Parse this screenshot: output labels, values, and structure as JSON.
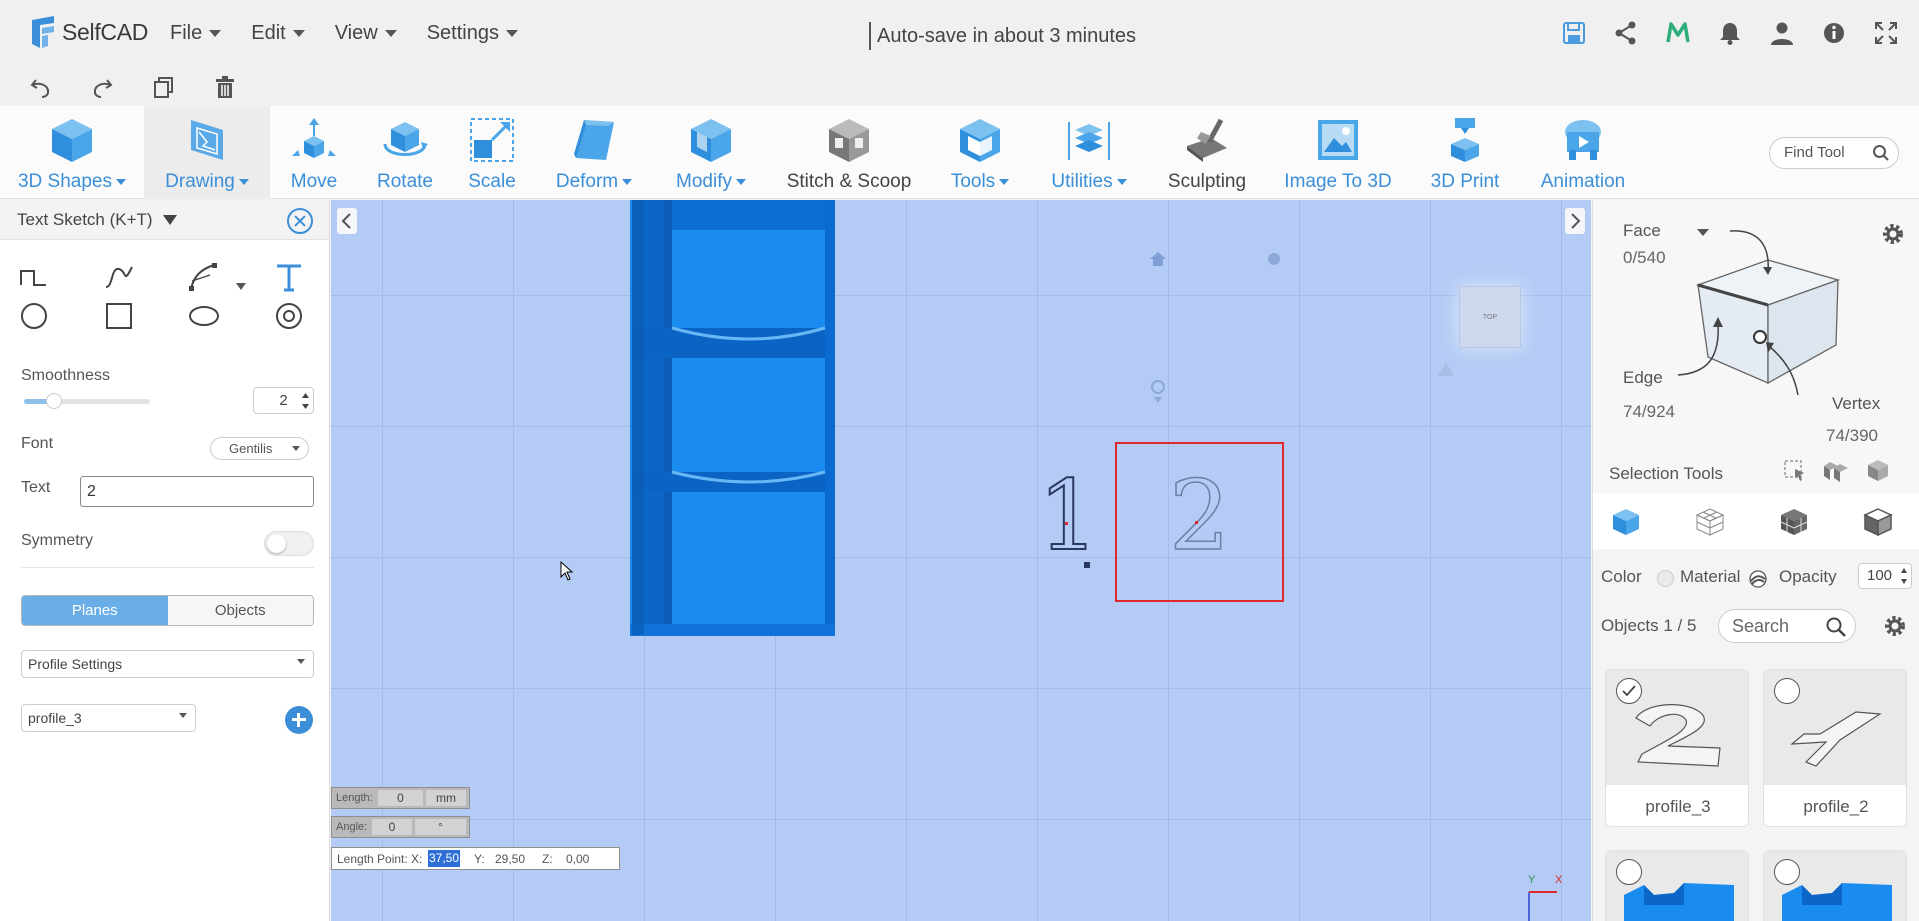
{
  "app": {
    "name": "SelfCAD",
    "menus": [
      "File",
      "Edit",
      "View",
      "Settings"
    ],
    "autosave": "Auto-save in about 3 minutes",
    "top_icons": [
      "save-icon",
      "share-icon",
      "m-icon",
      "bell-icon",
      "user-icon",
      "info-icon",
      "fullscreen-icon"
    ],
    "undo_icons": [
      "undo-icon",
      "redo-icon",
      "copy-icon",
      "trash-icon"
    ]
  },
  "toolbar": {
    "tools": [
      {
        "label": "3D Shapes",
        "dropdown": true
      },
      {
        "label": "Drawing",
        "dropdown": true
      },
      {
        "label": "Move",
        "dropdown": false
      },
      {
        "label": "Rotate",
        "dropdown": false
      },
      {
        "label": "Scale",
        "dropdown": false
      },
      {
        "label": "Deform",
        "dropdown": true
      },
      {
        "label": "Modify",
        "dropdown": true
      },
      {
        "label": "Stitch & Scoop",
        "dropdown": false
      },
      {
        "label": "Tools",
        "dropdown": true
      },
      {
        "label": "Utilities",
        "dropdown": true
      },
      {
        "label": "Sculpting",
        "dropdown": false
      },
      {
        "label": "Image To 3D",
        "dropdown": false
      },
      {
        "label": "3D Print",
        "dropdown": false
      },
      {
        "label": "Animation",
        "dropdown": false
      }
    ],
    "find_tool_placeholder": "Find Tool"
  },
  "left_panel": {
    "title": "Text Sketch (K+T)",
    "smoothness_label": "Smoothness",
    "smoothness_value": "2",
    "font_label": "Font",
    "font_value": "Gentilis",
    "text_label": "Text",
    "text_value": "2",
    "symmetry_label": "Symmetry",
    "symmetry_on": false,
    "segment": [
      "Planes",
      "Objects"
    ],
    "segment_active": "Planes",
    "profile_settings": "Profile Settings",
    "profile_select": "profile_3"
  },
  "canvas": {
    "length_label": "Length:",
    "length_value": "0",
    "length_unit": "mm",
    "angle_label": "Angle:",
    "angle_value": "0",
    "angle_unit": "°",
    "length_point_label": "Length Point: X:",
    "x_value": "37,50",
    "y_label": "Y:",
    "y_value": "29,50",
    "z_label": "Z:",
    "z_value": "0,00",
    "digit_one": "1",
    "digit_two": "2",
    "viewcube_label": "TOP",
    "axis_y": "Y",
    "axis_x": "X"
  },
  "right_panel": {
    "face_label": "Face",
    "face_count": "0/540",
    "edge_label": "Edge",
    "edge_count": "74/924",
    "vertex_label": "Vertex",
    "vertex_count": "74/390",
    "selection_tools": "Selection Tools",
    "color_label": "Color",
    "material_label": "Material",
    "opacity_label": "Opacity",
    "opacity_value": "100",
    "objects_label": "Objects 1 / 5",
    "search_placeholder": "Search",
    "objects": [
      {
        "name": "profile_3",
        "checked": true
      },
      {
        "name": "profile_2",
        "checked": false
      },
      {
        "name": "",
        "checked": false
      },
      {
        "name": "",
        "checked": false
      }
    ]
  },
  "colors": {
    "accent": "#3b8fd8",
    "canvas_bg": "#b3cbf5",
    "object_blue": "#1a8cf0",
    "selection_red": "#e0292b"
  }
}
